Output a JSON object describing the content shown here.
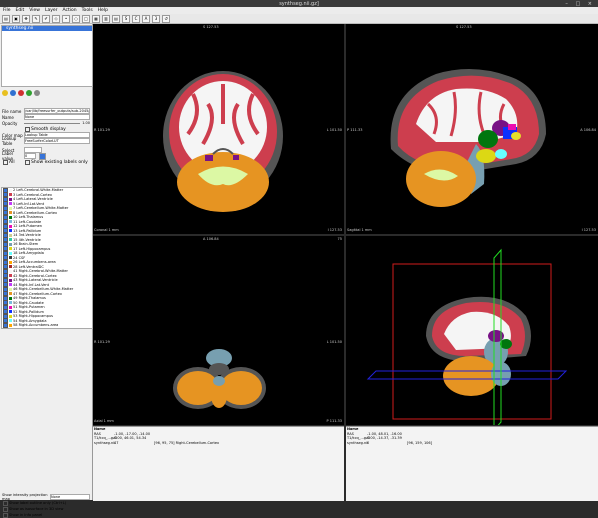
{
  "window": {
    "title": "synthseg.nii.gz]"
  },
  "menu": [
    "File",
    "Edit",
    "View",
    "Layer",
    "Action",
    "Tools",
    "Help"
  ],
  "layers": {
    "selected": "synthseg.nii"
  },
  "props": {
    "file_name_label": "File name",
    "file_name": "/var/lib/freesurfer_outputs/sub-2045/synthseg/synthseg.nii.gz",
    "name_label": "Name",
    "name": "None",
    "opacity_label": "Opacity",
    "opacity_value": "1.00",
    "smooth_label": "Smooth display",
    "color_map_label": "Color map",
    "color_map": "Lookup Table",
    "lookup_label": "Lookup Table",
    "lookup": "FreeSurferColorLUT",
    "select_label": "Select",
    "label_value_label": "Label value",
    "label_value": "0",
    "all_label": "All",
    "existing_label": "Show existing labels only"
  },
  "labels": [
    {
      "text": "2 Left-Cerebral-White-Matter",
      "color": "#f5f5f5"
    },
    {
      "text": "3 Left-Cerebral-Cortex",
      "color": "#cd3e4e"
    },
    {
      "text": "4 Left-Lateral-Ventricle",
      "color": "#781286"
    },
    {
      "text": "5 Left-Inf-Lat-Vent",
      "color": "#c43afa"
    },
    {
      "text": "7 Left-Cerebellum-White-Matter",
      "color": "#dcf8a4"
    },
    {
      "text": "8 Left-Cerebellum-Cortex",
      "color": "#e69422"
    },
    {
      "text": "10 Left-Thalamus",
      "color": "#00760e"
    },
    {
      "text": "11 Left-Caudate",
      "color": "#7abadc"
    },
    {
      "text": "12 Left-Putamen",
      "color": "#ec0db0"
    },
    {
      "text": "13 Left-Pallidum",
      "color": "#0c30ff"
    },
    {
      "text": "14 3rd-Ventricle",
      "color": "#cccc8e"
    },
    {
      "text": "15 4th-Ventricle",
      "color": "#2acca4"
    },
    {
      "text": "16 Brain-Stem",
      "color": "#779fb0"
    },
    {
      "text": "17 Left-Hippocampus",
      "color": "#dcd814"
    },
    {
      "text": "18 Left-Amygdala",
      "color": "#67ffff"
    },
    {
      "text": "24 CSF",
      "color": "#3c3c3c"
    },
    {
      "text": "26 Left-Accumbens-area",
      "color": "#ffa500"
    },
    {
      "text": "28 Left-VentralDC",
      "color": "#a52a2a"
    },
    {
      "text": "41 Right-Cerebral-White-Matter",
      "color": "#f5f5f5"
    },
    {
      "text": "42 Right-Cerebral-Cortex",
      "color": "#cd3e4e"
    },
    {
      "text": "43 Right-Lateral-Ventricle",
      "color": "#781286"
    },
    {
      "text": "44 Right-Inf-Lat-Vent",
      "color": "#c43afa"
    },
    {
      "text": "46 Right-Cerebellum-White-Matter",
      "color": "#dcf8a4"
    },
    {
      "text": "47 Right-Cerebellum-Cortex",
      "color": "#e69422"
    },
    {
      "text": "49 Right-Thalamus",
      "color": "#00760e"
    },
    {
      "text": "50 Right-Caudate",
      "color": "#7abadc"
    },
    {
      "text": "51 Right-Putamen",
      "color": "#ec0db0"
    },
    {
      "text": "52 Right-Pallidum",
      "color": "#0d30ff"
    },
    {
      "text": "53 Right-Hippocampus",
      "color": "#dcd814"
    },
    {
      "text": "54 Right-Amygdala",
      "color": "#67ffff"
    },
    {
      "text": "58 Right-Accumbens-area",
      "color": "#ffa500"
    },
    {
      "text": "60 Right-VentralDC",
      "color": "#a52a2a"
    }
  ],
  "bottom_options": {
    "mip_label": "Show intensity projection map",
    "mip_value": "None",
    "outline": "Show label outline only (Ctrl+L)",
    "iso": "Show as isosurface in 3D view",
    "info": "Show in Info panel"
  },
  "views": {
    "a": {
      "top": "S 127.53",
      "left": "R 101.29",
      "right": "L 101.50",
      "bottom": "I 127.53",
      "bl": "Coronal  1 mm"
    },
    "b": {
      "top": "S 127.53",
      "left": "P 111.33",
      "right": "A 106.84",
      "bottom": "I 127.53",
      "bl": "Sagittal  1 mm"
    },
    "c": {
      "top": "A 106.84",
      "left": "R 101.29",
      "right": "L 101.50",
      "bottom": "P 111.33",
      "tr": "75",
      "bl": "Axial  1 mm"
    }
  },
  "info_left": {
    "header": "Name",
    "rows": [
      {
        "a": "RAS",
        "b": "-1.00, -17.00, -14.00",
        "c": ""
      },
      {
        "a": "T1/kcq_...gz3",
        "b": "0.00, 46.01, 54.34",
        "c": ""
      },
      {
        "a": "synthseg.nii",
        "b": "47",
        "c": "[96, 95, 75]  Right-Cerebellum-Cortex"
      }
    ]
  },
  "info_right": {
    "header": "Name",
    "rows": [
      {
        "a": "RAS",
        "b": "-1.00, 48.01, -16.00",
        "c": ""
      },
      {
        "a": "T1/kcq_...gz3",
        "b": "0.00, -14.37, -31.39",
        "c": ""
      },
      {
        "a": "synthseg.nii",
        "b": "0",
        "c": "[96, 159, 106]"
      }
    ]
  },
  "colors": {
    "cortex": "#cd3e4e",
    "wm": "#f5f5f5",
    "csf": "#555555",
    "cb_cortex": "#e69422",
    "cb_wm": "#dcf8a4",
    "stem": "#779fb0",
    "thal": "#00760e",
    "caud": "#7abadc",
    "vent": "#781286",
    "box": "#d11b1b",
    "sagplane": "#22dd22",
    "axplane": "#2222dd"
  }
}
